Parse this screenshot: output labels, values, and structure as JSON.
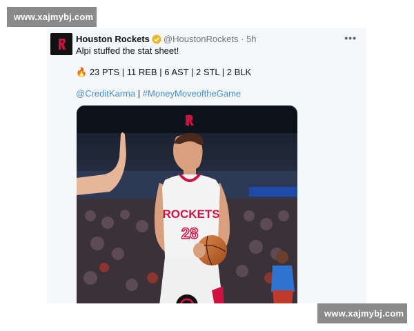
{
  "watermarks": {
    "top": "www.xajmybj.com",
    "bottom": "www.xajmybj.com"
  },
  "tweet": {
    "author_name": "Houston Rockets",
    "handle": "@HoustonRockets",
    "separator": "·",
    "time": "5h",
    "more_label": "•••",
    "text": "Alpi stuffed the stat sheet!",
    "stats_emoji": "🔥",
    "stats": "23 PTS | 11 REB | 6 AST | 2 STL | 2 BLK",
    "link1": "@CreditKarma",
    "link_separator": " | ",
    "link2": "#MoneyMoveoftheGame"
  },
  "image": {
    "jersey_team": "ROCKETS",
    "jersey_number": "28"
  },
  "colors": {
    "verified_badge": "#e8b923",
    "link": "#3f8fd3",
    "rockets_red": "#ce1141"
  },
  "icons": {
    "avatar": "rockets-logo-icon",
    "verified": "verified-badge-icon",
    "more": "more-options-icon"
  }
}
